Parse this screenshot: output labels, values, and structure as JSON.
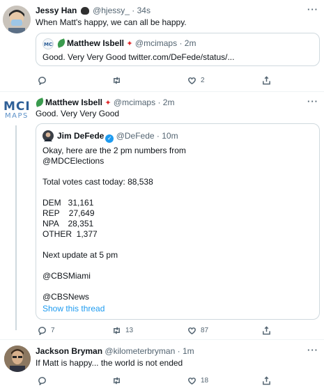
{
  "tweets": [
    {
      "name": "Jessy Han",
      "handle": "@hjessy_",
      "time": "· 34s",
      "text": "When Matt's happy, we can all be happy.",
      "quote": {
        "name": "Matthew Isbell",
        "handle": "@mcimaps",
        "time": "· 2m",
        "text": "Good.  Very Very Good twitter.com/DeFede/status/..."
      },
      "reply_count": "",
      "retweet_count": "",
      "like_count": "2"
    },
    {
      "name": "Matthew Isbell",
      "handle": "@mcimaps",
      "time": "· 2m",
      "avatar_text_top": "MCI",
      "avatar_text_bottom": "MAPS",
      "text": "Good.  Very Very Good",
      "quote": {
        "name": "Jim DeFede",
        "handle": "@DeFede",
        "time": "· 10m",
        "lines": [
          "Okay, here are the 2 pm numbers from",
          "@MDCElections",
          "",
          "Total votes cast today: 88,538",
          "",
          "DEM   31,161",
          "REP    27,649",
          "NPA    28,351",
          "OTHER  1,377",
          "",
          "Next update at 5 pm",
          "",
          "@CBSMiami",
          "",
          "@CBSNews"
        ],
        "show_thread": "Show this thread"
      },
      "reply_count": "7",
      "retweet_count": "13",
      "like_count": "87"
    },
    {
      "name": "Jackson Bryman",
      "handle": "@kilometerbryman",
      "time": "· 1m",
      "text": "If Matt is happy... the world is not ended",
      "reply_count": "",
      "retweet_count": "",
      "like_count": "18"
    }
  ],
  "more_label": "···",
  "colors": {
    "accent": "#1d9bf0",
    "secondary_text": "#536471",
    "border": "#cfd9de",
    "maple": "#e0292b",
    "leaf": "#3a9b4e"
  },
  "icons": [
    "reply-icon",
    "retweet-icon",
    "like-icon",
    "share-icon",
    "verified-icon",
    "maple-leaf-icon",
    "leaf-icon",
    "turkey-icon"
  ]
}
